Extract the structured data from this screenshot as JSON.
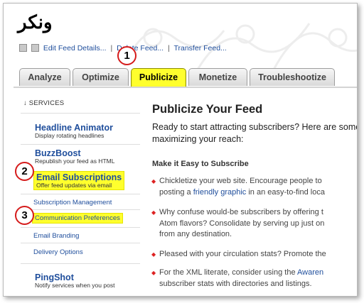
{
  "feed": {
    "title": "ونكر",
    "actions": [
      "Edit Feed Details...",
      "Delete Feed...",
      "Transfer Feed..."
    ],
    "separator": "|"
  },
  "tabs": [
    {
      "label": "Analyze",
      "active": false
    },
    {
      "label": "Optimize",
      "active": false
    },
    {
      "label": "Publicize",
      "active": true
    },
    {
      "label": "Monetize",
      "active": false
    },
    {
      "label": "Troubleshootize",
      "active": false
    }
  ],
  "sidebar": {
    "heading": "↓ SERVICES",
    "services": [
      {
        "title": "Headline Animator",
        "subtitle": "Display rotating headlines"
      },
      {
        "title": "BuzzBoost",
        "subtitle": "Republish your feed as HTML"
      },
      {
        "title": "Email Subscriptions",
        "subtitle": "Offer feed updates via email"
      }
    ],
    "email_links": [
      "Subscription Management",
      "Communication Preferences",
      "Email Branding",
      "Delivery Options"
    ],
    "pingshot": {
      "title": "PingShot",
      "subtitle": "Notify services when you post"
    }
  },
  "main": {
    "title": "Publicize Your Feed",
    "intro_lines": [
      "Ready to start attracting subscribers? Here are some",
      "maximizing your reach:"
    ],
    "subscribe_heading": "Make it Easy to Subscribe",
    "bullets": [
      {
        "lines": [
          "Chickletize your web site. Encourage people to",
          "posting a ",
          "friendly graphic",
          " in an easy-to-find loca"
        ]
      },
      {
        "lines": [
          "Why confuse would-be subscribers by offering t",
          "Atom flavors? Consolidate by serving up just on",
          "from any destination."
        ]
      },
      {
        "lines": [
          "Pleased with your circulation stats? Promote the"
        ]
      },
      {
        "lines": [
          "For the XML literate, consider using the ",
          "Awaren",
          "subscriber stats with directories and listings."
        ]
      }
    ]
  },
  "annotations": [
    "1",
    "2",
    "3"
  ],
  "colors": {
    "highlight": "#ffff2d",
    "badge_border": "#d51b1b",
    "link": "#1f4e9c"
  }
}
